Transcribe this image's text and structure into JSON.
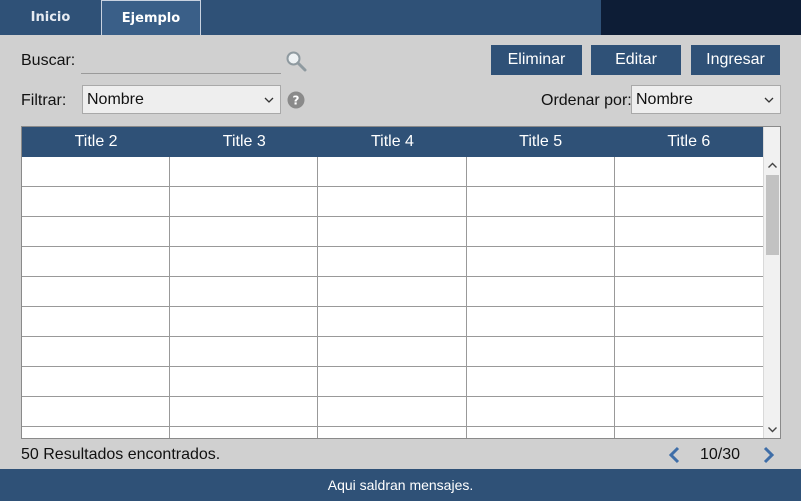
{
  "tabs": [
    {
      "label": "Inicio",
      "active": false
    },
    {
      "label": "Ejemplo",
      "active": true
    }
  ],
  "search": {
    "label": "Buscar:",
    "value": "",
    "placeholder": ""
  },
  "toolbar": {
    "delete_label": "Eliminar",
    "edit_label": "Editar",
    "insert_label": "Ingresar"
  },
  "filter": {
    "label": "Filtrar:",
    "selected": "Nombre"
  },
  "sort": {
    "label": "Ordenar por:",
    "selected": "Nombre"
  },
  "table": {
    "columns": [
      "Title 2",
      "Title 3",
      "Title 4",
      "Title 5",
      "Title 6"
    ],
    "rows": [
      [
        "",
        "",
        "",
        "",
        ""
      ],
      [
        "",
        "",
        "",
        "",
        ""
      ],
      [
        "",
        "",
        "",
        "",
        ""
      ],
      [
        "",
        "",
        "",
        "",
        ""
      ],
      [
        "",
        "",
        "",
        "",
        ""
      ],
      [
        "",
        "",
        "",
        "",
        ""
      ],
      [
        "",
        "",
        "",
        "",
        ""
      ],
      [
        "",
        "",
        "",
        "",
        ""
      ],
      [
        "",
        "",
        "",
        "",
        ""
      ],
      [
        "",
        "",
        "",
        "",
        ""
      ]
    ]
  },
  "results_text": "50 Resultados encontrados.",
  "pager": {
    "text": "10/30"
  },
  "status_message": "Aqui saldran mensajes.",
  "colors": {
    "primary": "#2f5177",
    "dark": "#0d1d36",
    "background": "#d0d0d0"
  },
  "icons": [
    "search-icon",
    "help-icon",
    "chevron-down-icon",
    "chevron-left-icon",
    "chevron-right-icon"
  ]
}
